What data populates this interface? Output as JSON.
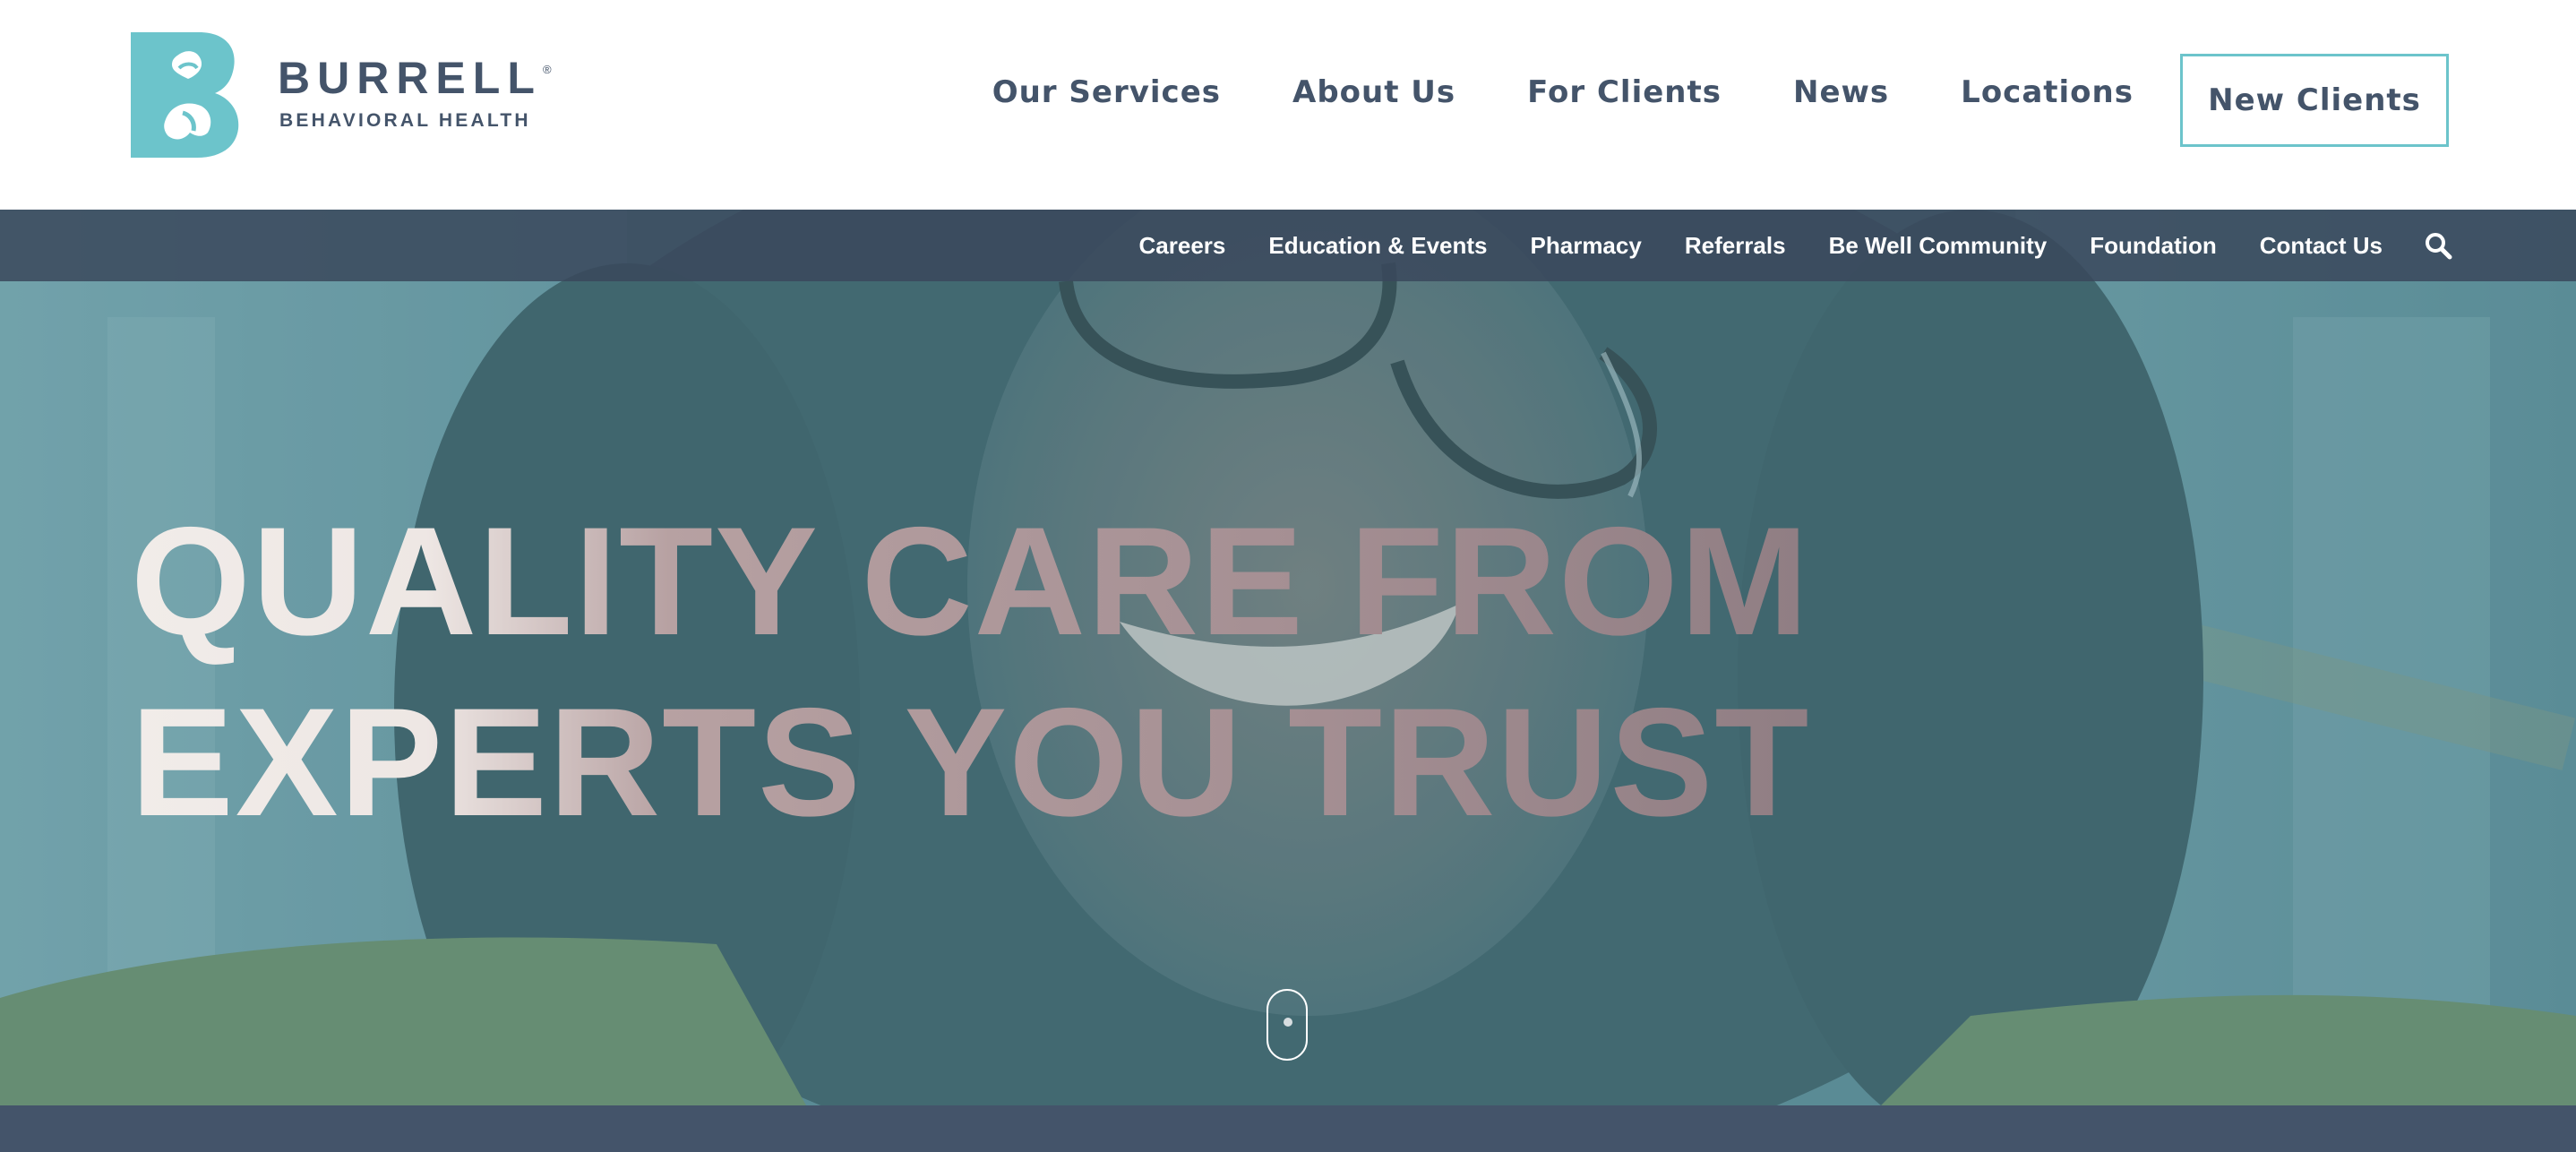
{
  "brand": {
    "name": "BURRELL",
    "registered": "®",
    "subtitle": "BEHAVIORAL HEALTH"
  },
  "main_nav": {
    "items": [
      {
        "label": "Our Services"
      },
      {
        "label": "About Us"
      },
      {
        "label": "For Clients"
      },
      {
        "label": "News"
      },
      {
        "label": "Locations"
      }
    ],
    "cta_label": "New Clients"
  },
  "sub_nav": {
    "items": [
      {
        "label": "Careers"
      },
      {
        "label": "Education & Events"
      },
      {
        "label": "Pharmacy"
      },
      {
        "label": "Referrals"
      },
      {
        "label": "Be Well Community"
      },
      {
        "label": "Foundation"
      },
      {
        "label": "Contact Us"
      }
    ],
    "search_icon": "search-icon"
  },
  "hero": {
    "headline_line_1": "QUALITY CARE FROM",
    "headline_line_2": "EXPERTS YOU TRUST",
    "scroll_icon": "mouse-scroll-icon"
  },
  "colors": {
    "brand_teal": "#6cc4cb",
    "brand_slate": "#44546a",
    "subnav_bg": "#3a485c"
  }
}
